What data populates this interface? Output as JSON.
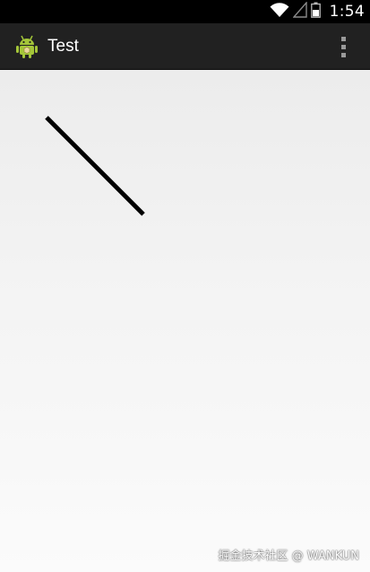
{
  "status_bar": {
    "time": "1:54",
    "icons": [
      "wifi-icon",
      "cell-signal-icon",
      "battery-icon"
    ]
  },
  "action_bar": {
    "title": "Test",
    "app_icon": "android-icon",
    "overflow_icon": "overflow-menu-icon"
  },
  "canvas": {
    "line_color": "#000000"
  },
  "watermark": {
    "text": "掘金技术社区 @ WANKUN"
  }
}
